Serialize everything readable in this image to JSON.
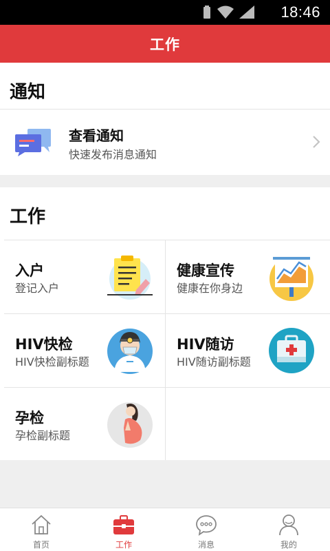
{
  "status_bar": {
    "time": "18:46",
    "icons": [
      "battery-icon",
      "wifi-icon",
      "cell-signal-icon"
    ]
  },
  "header": {
    "title": "工作"
  },
  "notice_section": {
    "title": "通知",
    "item": {
      "title": "查看通知",
      "subtitle": "快速发布消息通知",
      "icon": "chat-bubbles-icon"
    }
  },
  "work_section": {
    "title": "工作",
    "tiles": [
      {
        "title": "入户",
        "subtitle": "登记入户",
        "icon": "clipboard-icon"
      },
      {
        "title": "健康宣传",
        "subtitle": "健康在你身边",
        "icon": "chart-board-icon"
      },
      {
        "title": "HIV快检",
        "subtitle": "HIV快检副标题",
        "icon": "doctor-icon"
      },
      {
        "title": "HIV随访",
        "subtitle": "HIV随访副标题",
        "icon": "medical-kit-icon"
      },
      {
        "title": "孕检",
        "subtitle": "孕检副标题",
        "icon": "pregnant-woman-icon"
      }
    ]
  },
  "bottom_nav": {
    "items": [
      {
        "label": "首页",
        "icon": "home-icon",
        "active": false
      },
      {
        "label": "工作",
        "icon": "briefcase-icon",
        "active": true
      },
      {
        "label": "消息",
        "icon": "message-icon",
        "active": false
      },
      {
        "label": "我的",
        "icon": "user-icon",
        "active": false
      }
    ]
  },
  "colors": {
    "accent": "#e03a3c",
    "background": "#efefef",
    "inactive_nav": "#777777"
  }
}
